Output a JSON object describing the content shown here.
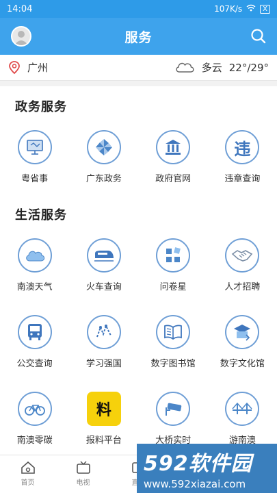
{
  "status_bar": {
    "time": "14:04",
    "speed": "107K/s",
    "battery": "X"
  },
  "header": {
    "title": "服务"
  },
  "location": {
    "city": "广州",
    "weather": "多云",
    "temperature": "22°/29°"
  },
  "sections": {
    "gov": {
      "title": "政务服务",
      "items": [
        {
          "label": "粤省事",
          "icon": "computer-icon"
        },
        {
          "label": "广东政务",
          "icon": "pinwheel-icon"
        },
        {
          "label": "政府官网",
          "icon": "government-building-icon"
        },
        {
          "label": "违章查询",
          "icon": "violation-icon",
          "glyph": "违"
        }
      ]
    },
    "life": {
      "title": "生活服务",
      "items": [
        {
          "label": "南澳天气",
          "icon": "cloud-icon"
        },
        {
          "label": "火车查询",
          "icon": "train-icon"
        },
        {
          "label": "问卷星",
          "icon": "grid-icon"
        },
        {
          "label": "人才招聘",
          "icon": "handshake-icon"
        },
        {
          "label": "公交查询",
          "icon": "bus-icon"
        },
        {
          "label": "学习强国",
          "icon": "study-icon"
        },
        {
          "label": "数字图书馆",
          "icon": "book-icon"
        },
        {
          "label": "数字文化馆",
          "icon": "culture-icon"
        },
        {
          "label": "南澳零碳",
          "icon": "bicycle-icon"
        },
        {
          "label": "报料平台",
          "icon": "report-icon",
          "glyph": "料"
        },
        {
          "label": "大桥实时",
          "icon": "camera-icon"
        },
        {
          "label": "游南澳",
          "icon": "bridge-icon"
        }
      ]
    }
  },
  "tabbar": [
    {
      "label": "首页",
      "icon": "home-icon"
    },
    {
      "label": "电视",
      "icon": "tv-icon"
    },
    {
      "label": "直播",
      "icon": "play-icon"
    }
  ],
  "watermark": {
    "brand": "592软件园",
    "url": "www.592xiazai.com"
  },
  "colors": {
    "header": "#3ea3ec",
    "icon_ring": "#6f9fd6",
    "report_yellow": "#f6d10c"
  }
}
